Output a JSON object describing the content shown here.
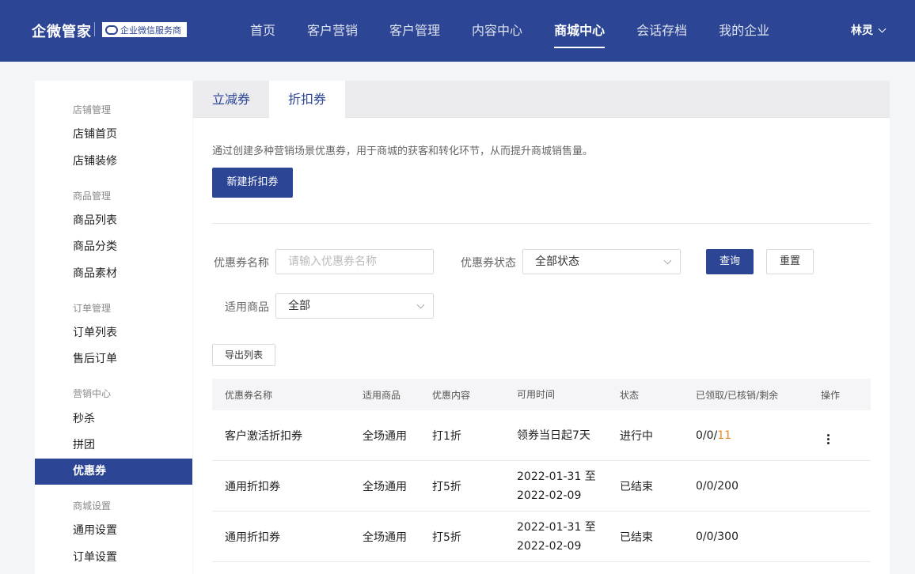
{
  "header": {
    "brand": "企微管家",
    "partner_label": "企业微信服务商",
    "nav": [
      {
        "label": "首页"
      },
      {
        "label": "客户营销"
      },
      {
        "label": "客户管理"
      },
      {
        "label": "内容中心"
      },
      {
        "label": "商城中心",
        "active": true
      },
      {
        "label": "会话存档"
      },
      {
        "label": "我的企业"
      }
    ],
    "user": "林灵"
  },
  "sidebar": {
    "groups": [
      {
        "title": "店铺管理",
        "items": [
          "店铺首页",
          "店铺装修"
        ]
      },
      {
        "title": "商品管理",
        "items": [
          "商品列表",
          "商品分类",
          "商品素材"
        ]
      },
      {
        "title": "订单管理",
        "items": [
          "订单列表",
          "售后订单"
        ]
      },
      {
        "title": "营销中心",
        "items": [
          "秒杀",
          "拼团",
          "优惠券"
        ]
      },
      {
        "title": "商城设置",
        "items": [
          "通用设置",
          "订单设置"
        ]
      }
    ],
    "active_item": "优惠券"
  },
  "tabs": [
    {
      "label": "立减券"
    },
    {
      "label": "折扣券",
      "active": true
    }
  ],
  "description": "通过创建多种营销场景优惠券，用于商城的获客和转化环节，从而提升商城销售量。",
  "create_button": "新建折扣券",
  "filters": {
    "name_label": "优惠券名称",
    "name_placeholder": "请输入优惠券名称",
    "status_label": "优惠券状态",
    "status_value": "全部状态",
    "goods_label": "适用商品",
    "goods_value": "全部",
    "query_button": "查询",
    "reset_button": "重置"
  },
  "export_button": "导出列表",
  "table": {
    "columns": [
      "优惠券名称",
      "适用商品",
      "优惠内容",
      "可用时间",
      "状态",
      "已领取/已核销/剩余",
      "操作"
    ],
    "rows": [
      {
        "name": "客户激活折扣券",
        "goods": "全场通用",
        "discount": "打1折",
        "time_line1": "领券当日起7天",
        "time_line2": "",
        "status": "进行中",
        "counts_prefix": "0/0/",
        "counts_highlight": "11",
        "has_action": true
      },
      {
        "name": "通用折扣券",
        "goods": "全场通用",
        "discount": "打5折",
        "time_line1": "2022-01-31 至",
        "time_line2": "2022-02-09",
        "status": "已结束",
        "counts_prefix": "0/0/200",
        "counts_highlight": "",
        "has_action": false
      },
      {
        "name": "通用折扣券",
        "goods": "全场通用",
        "discount": "打5折",
        "time_line1": "2022-01-31 至",
        "time_line2": "2022-02-09",
        "status": "已结束",
        "counts_prefix": "0/0/300",
        "counts_highlight": "",
        "has_action": false
      }
    ]
  },
  "colors": {
    "primary": "#2c4594",
    "highlight": "#e8892b"
  }
}
